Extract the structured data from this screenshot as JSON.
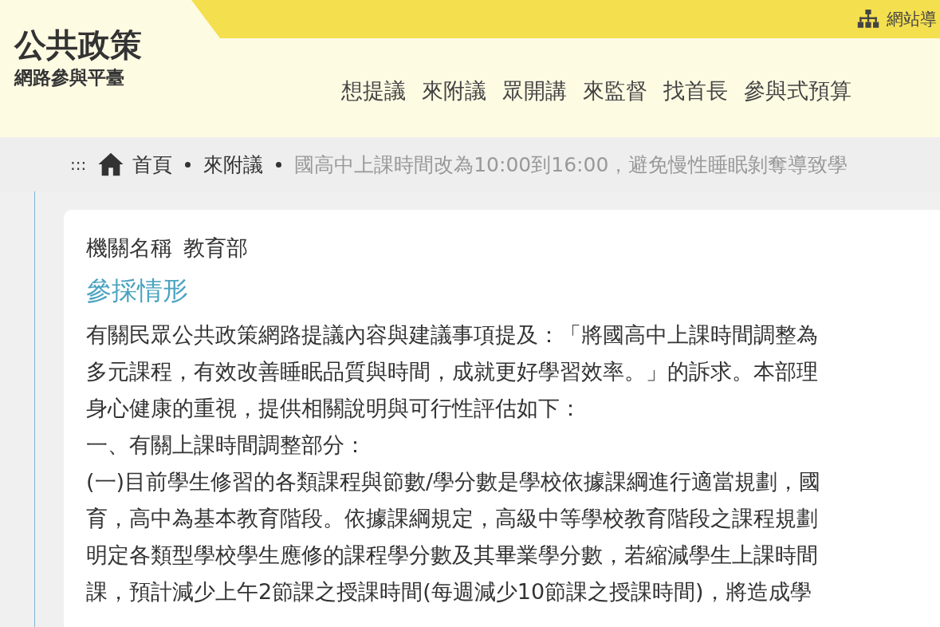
{
  "logo": {
    "title": "公共政策",
    "subtitle": "網路參與平臺"
  },
  "utility_link": "網站導",
  "nav": [
    "想提議",
    "來附議",
    "眾開講",
    "來監督",
    "找首長",
    "參與式預算"
  ],
  "breadcrumb": {
    "marker": ":::",
    "items": [
      {
        "label": "首頁",
        "kind": "home"
      },
      {
        "label": "來附議",
        "kind": "link"
      },
      {
        "label": "國高中上課時間改為10:00到16:00，避免慢性睡眠剝奪導致學",
        "kind": "current"
      }
    ]
  },
  "agency": {
    "label": "機關名稱",
    "value": "教育部"
  },
  "section_title": "參採情形",
  "paragraph_lines": [
    "有關民眾公共政策網路提議內容與建議事項提及：「將國高中上課時間調整為",
    "多元課程，有效改善睡眠品質與時間，成就更好學習效率。」的訴求。本部理",
    "身心健康的重視，提供相關說明與可行性評估如下：",
    "一、有關上課時間調整部分：",
    "(一)目前學生修習的各類課程與節數/學分數是學校依據課綱進行適當規劃，國",
    "育，高中為基本教育階段。依據課綱規定，高級中等學校教育階段之課程規劃",
    "明定各類型學校學生應修的課程學分數及其畢業學分數，若縮減學生上課時間",
    "課，預計減少上午2節課之授課時間(每週減少10節課之授課時間)，將造成學"
  ]
}
